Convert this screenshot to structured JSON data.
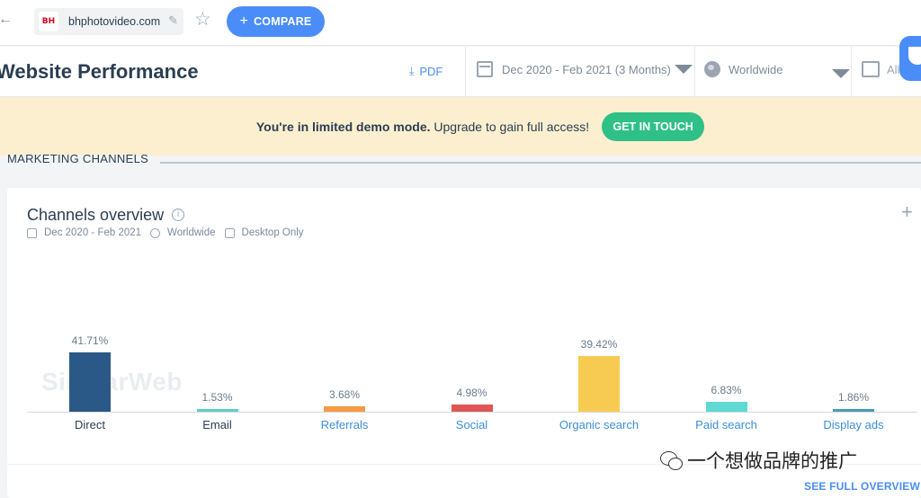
{
  "toolbar": {
    "domain": "bhphotovideo.com",
    "favicon_text": "BH",
    "compare_label": "COMPARE"
  },
  "header": {
    "title": "Website Performance",
    "pdf_label": "PDF",
    "date_range": "Dec 2020 - Feb 2021 (3 Months)",
    "geo": "Worldwide",
    "device": "All"
  },
  "banner": {
    "bold_text": "You're in limited demo mode.",
    "text": " Upgrade to gain full access!",
    "button_label": "GET IN TOUCH"
  },
  "section": {
    "label": "MARKETING CHANNELS"
  },
  "card": {
    "title": "Channels overview",
    "sub_date": "Dec 2020 - Feb 2021",
    "sub_geo": "Worldwide",
    "sub_device": "Desktop Only",
    "watermark": "SimilarWeb",
    "see_full": "SEE FULL OVERVIEW"
  },
  "chart_data": {
    "type": "bar",
    "categories": [
      "Direct",
      "Email",
      "Referrals",
      "Social",
      "Organic search",
      "Paid search",
      "Display ads"
    ],
    "values": [
      41.71,
      1.53,
      3.68,
      4.98,
      39.42,
      6.83,
      1.86
    ],
    "labels": [
      "41.71%",
      "1.53%",
      "3.68%",
      "4.98%",
      "39.42%",
      "6.83%",
      "1.86%"
    ],
    "colors": [
      "#2b5987",
      "#5ccfc4",
      "#f79a45",
      "#e05656",
      "#f7cb52",
      "#5fd9d1",
      "#4a9ab0"
    ],
    "label_colors": [
      "#2a3e52",
      "#2a3e52",
      "#3b8fd8",
      "#3b8fd8",
      "#3b8fd8",
      "#3b8fd8",
      "#3b8fd8"
    ],
    "ylim": [
      0,
      45
    ]
  },
  "overlay": {
    "wechat_text": "一个想做品牌的推广"
  }
}
